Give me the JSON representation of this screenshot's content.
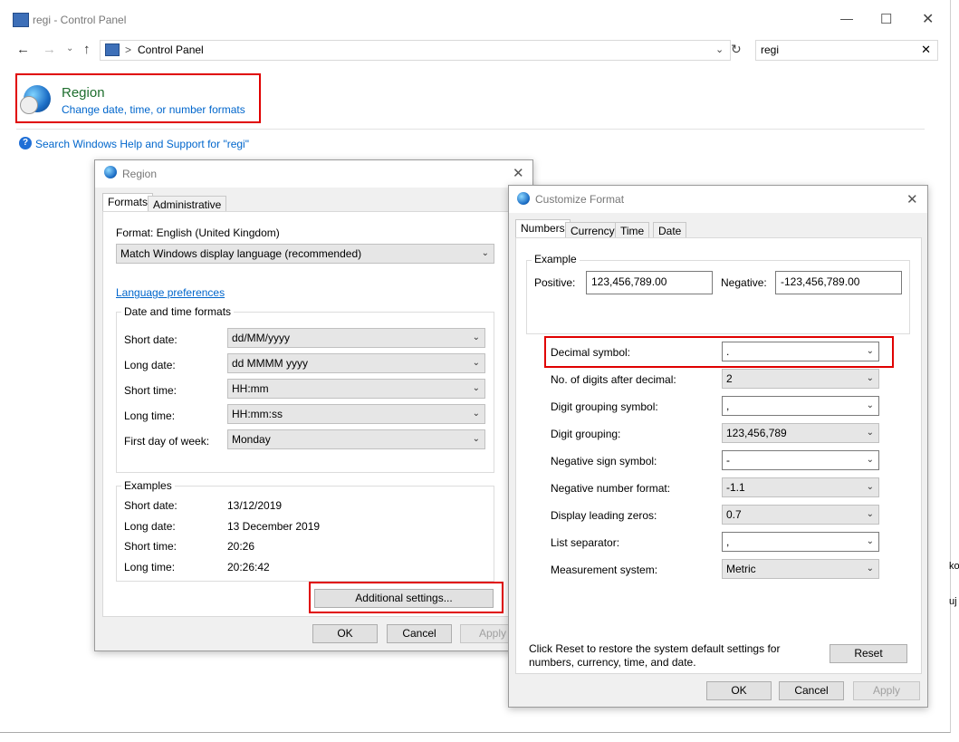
{
  "control_panel": {
    "title": "regi - Control Panel",
    "breadcrumb_sep": ">",
    "breadcrumb": "Control Panel",
    "search_value": "regi",
    "result_title": "Region",
    "result_subtitle": "Change date, time, or number formats",
    "help_link": "Search Windows Help and Support for \"regi\""
  },
  "region": {
    "title": "Region",
    "tabs": [
      "Formats",
      "Administrative"
    ],
    "format_label": "Format: English (United Kingdom)",
    "format_value": "Match Windows display language (recommended)",
    "lang_pref": "Language preferences",
    "dt_group": "Date and time formats",
    "dt_rows": [
      {
        "label": "Short date:",
        "value": "dd/MM/yyyy"
      },
      {
        "label": "Long date:",
        "value": "dd MMMM yyyy"
      },
      {
        "label": "Short time:",
        "value": "HH:mm"
      },
      {
        "label": "Long time:",
        "value": "HH:mm:ss"
      },
      {
        "label": "First day of week:",
        "value": "Monday"
      }
    ],
    "ex_group": "Examples",
    "ex_rows": [
      {
        "label": "Short date:",
        "value": "13/12/2019"
      },
      {
        "label": "Long date:",
        "value": "13 December 2019"
      },
      {
        "label": "Short time:",
        "value": "20:26"
      },
      {
        "label": "Long time:",
        "value": "20:26:42"
      }
    ],
    "additional": "Additional settings...",
    "ok": "OK",
    "cancel": "Cancel",
    "apply": "Apply"
  },
  "customize": {
    "title": "Customize Format",
    "tabs": [
      "Numbers",
      "Currency",
      "Time",
      "Date"
    ],
    "example_group": "Example",
    "positive_label": "Positive:",
    "positive_value": "123,456,789.00",
    "negative_label": "Negative:",
    "negative_value": "-123,456,789.00",
    "rows": [
      {
        "label": "Decimal symbol:",
        "value": "."
      },
      {
        "label": "No. of digits after decimal:",
        "value": "2"
      },
      {
        "label": "Digit grouping symbol:",
        "value": ","
      },
      {
        "label": "Digit grouping:",
        "value": "123,456,789"
      },
      {
        "label": "Negative sign symbol:",
        "value": "-"
      },
      {
        "label": "Negative number format:",
        "value": "-1.1"
      },
      {
        "label": "Display leading zeros:",
        "value": "0.7"
      },
      {
        "label": "List separator:",
        "value": ","
      },
      {
        "label": "Measurement system:",
        "value": "Metric"
      }
    ],
    "reset_text": "Click Reset to restore the system default settings for numbers, currency, time, and date.",
    "reset": "Reset",
    "ok": "OK",
    "cancel": "Cancel",
    "apply": "Apply"
  },
  "right_edge": [
    "ko",
    "uj"
  ]
}
